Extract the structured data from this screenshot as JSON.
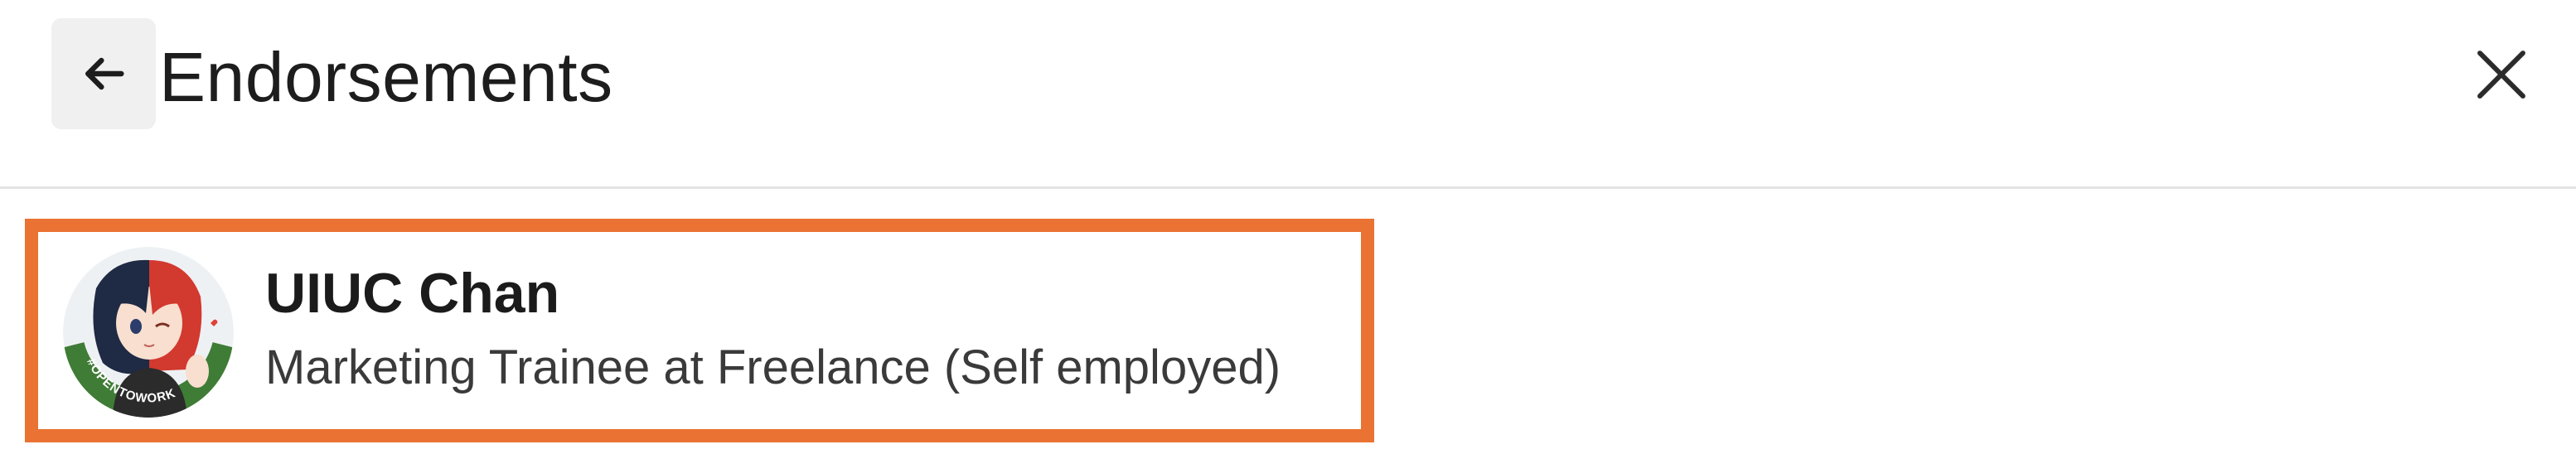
{
  "header": {
    "back_icon": "arrow-left-icon",
    "title": "Endorsements",
    "close_icon": "close-icon"
  },
  "endorsers": [
    {
      "name": "UIUC Chan",
      "headline": "Marketing Trainee at Freelance (Self employed)",
      "avatar_badge": "#OPENTOWORK"
    }
  ],
  "colors": {
    "highlight": "#ea7232",
    "open_to_work_ring": "#3f7c36",
    "divider": "#e3e3e3"
  }
}
